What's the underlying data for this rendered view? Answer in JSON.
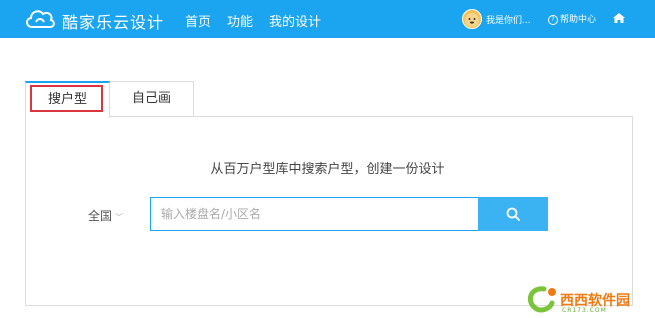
{
  "header": {
    "brand": "酷家乐云设计",
    "nav": [
      "首页",
      "功能",
      "我的设计"
    ],
    "username": "我是你们...",
    "help_label": "帮助中心",
    "background": "#1ba4f0"
  },
  "tabs": [
    {
      "label": "搜户型",
      "active": true
    },
    {
      "label": "自己画",
      "active": false
    }
  ],
  "search": {
    "subtitle": "从百万户型库中搜索户型，创建一份设计",
    "region": "全国",
    "placeholder": "输入楼盘名/小区名",
    "value": "",
    "button_icon": "search-icon",
    "accent": "#3bb3f3"
  },
  "watermark": {
    "text": "西西软件园",
    "sub": "CR173.COM"
  }
}
